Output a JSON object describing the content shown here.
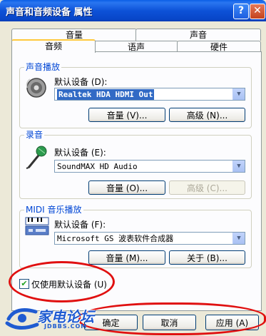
{
  "window": {
    "title": "声音和音频设备 属性",
    "help_glyph": "?",
    "close_glyph": "✕"
  },
  "tabs": {
    "row_back": [
      "音量",
      "声音"
    ],
    "row_front": [
      "音频",
      "语声",
      "硬件"
    ],
    "active": "音频"
  },
  "playback": {
    "title": "声音播放",
    "default_label": "默认设备 (D):",
    "device": "Realtek HDA HDMI Out",
    "volume_button": "音量 (V)...",
    "advanced_button": "高级 (N)...",
    "icon": "speaker-icon"
  },
  "recording": {
    "title": "录音",
    "default_label": "默认设备 (E):",
    "device": "SoundMAX HD Audio",
    "volume_button": "音量 (O)...",
    "advanced_button": "高级 (C)...",
    "icon": "microphone-icon"
  },
  "midi": {
    "title": "MIDI 音乐播放",
    "default_label": "默认设备 (F):",
    "device": "Microsoft GS 波表软件合成器",
    "volume_button": "音量 (M)...",
    "about_button": "关于 (B)...",
    "icon": "keyboard-icon"
  },
  "options": {
    "use_default_only": "仅使用默认设备 (U)",
    "checked": true
  },
  "footer": {
    "ok": "确定",
    "cancel": "取消",
    "apply": "应用 (A)"
  },
  "watermark": {
    "text": "家电论坛",
    "url": "JDBBS.COM"
  },
  "colors": {
    "title_bar": "#0a5fe6",
    "group_title": "#0046d5",
    "annotation": "#e01010"
  }
}
